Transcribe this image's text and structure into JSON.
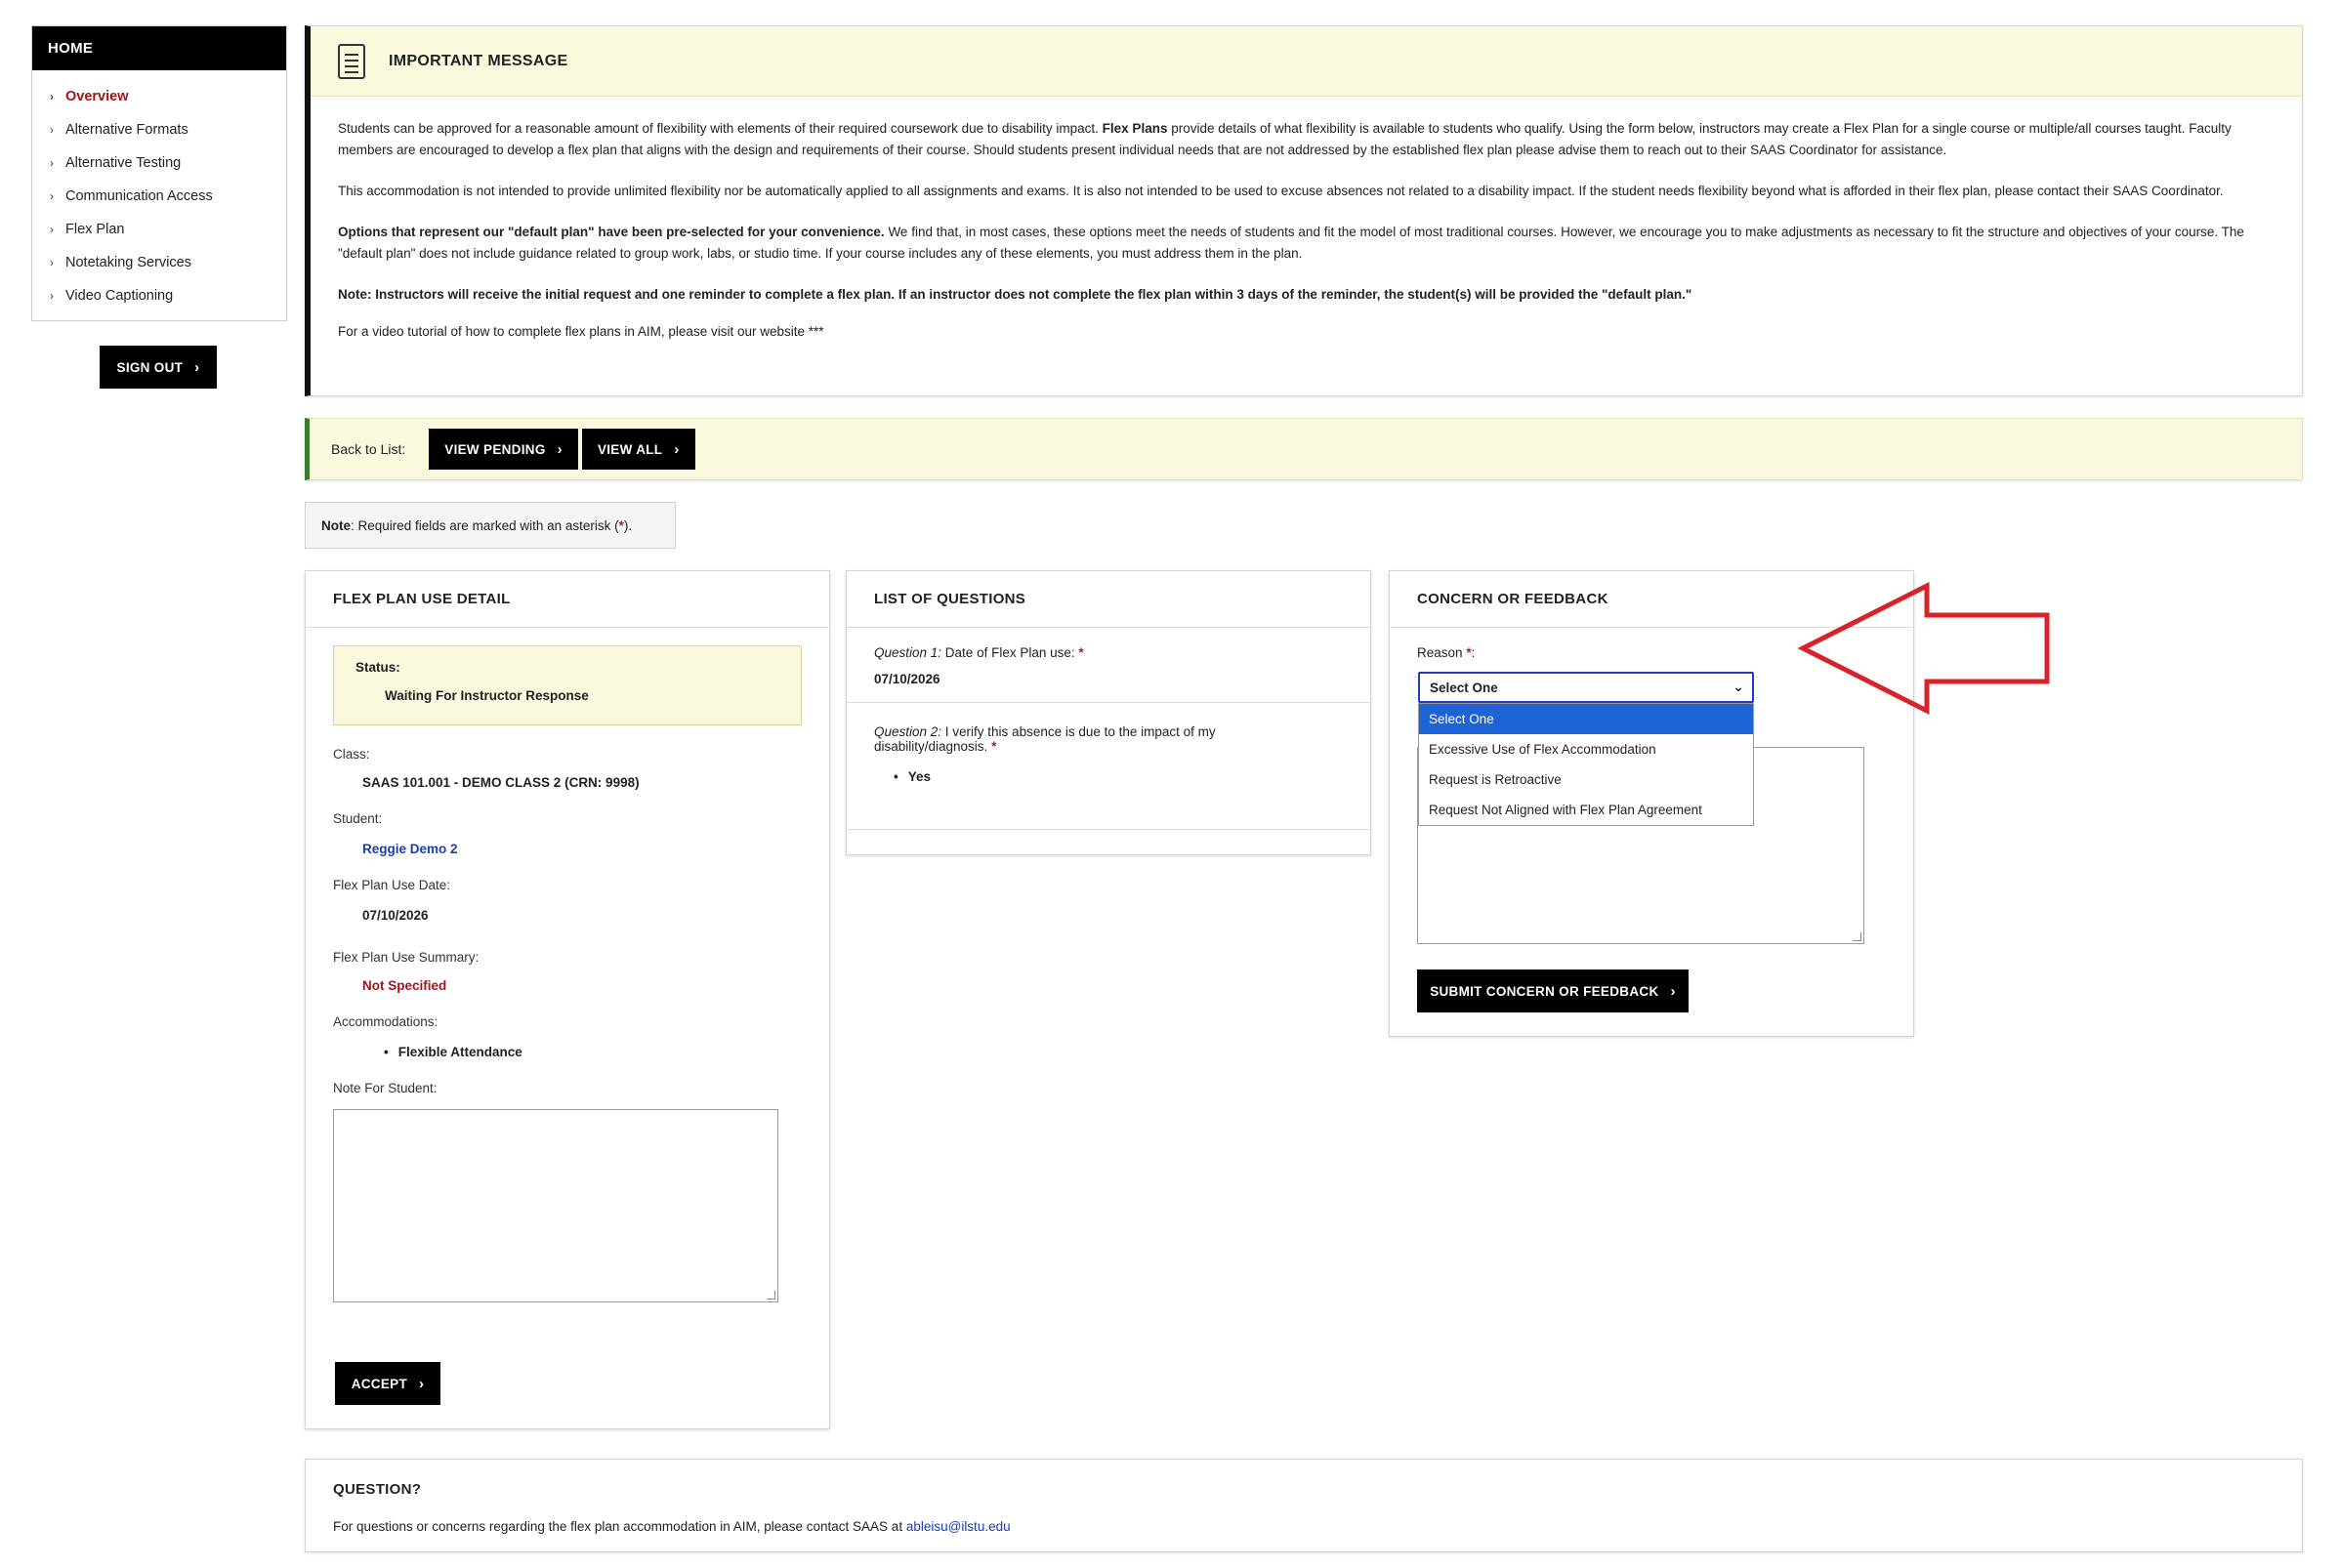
{
  "sidebar": {
    "heading": "HOME",
    "items": [
      {
        "label": "Overview"
      },
      {
        "label": "Alternative Formats"
      },
      {
        "label": "Alternative Testing"
      },
      {
        "label": "Communication Access"
      },
      {
        "label": "Flex Plan"
      },
      {
        "label": "Notetaking Services"
      },
      {
        "label": "Video Captioning"
      }
    ],
    "sign_out_label": "SIGN OUT"
  },
  "message": {
    "title": "IMPORTANT MESSAGE",
    "p1_a": "Students can be approved for a reasonable amount of flexibility with elements of their required coursework due to disability impact. ",
    "p1_bold": "Flex Plans",
    "p1_b": " provide details of what flexibility is available to students who qualify. Using the form below, instructors may create a Flex Plan for a single course or multiple/all courses taught. Faculty members are encouraged to develop a flex plan that aligns with the design and requirements of their course. Should students present individual needs that are not addressed by the established flex plan please advise them to reach out to their SAAS Coordinator for assistance.",
    "p2": "This accommodation is not intended to provide unlimited flexibility nor be automatically applied to all assignments and exams. It is also not intended to be used to excuse absences not related to a disability impact. If the student needs flexibility beyond what is afforded in their flex plan, please contact their SAAS Coordinator.",
    "p3_bold": "Options that represent our \"default plan\" have been pre-selected for your convenience.",
    "p3_rest": " We find that, in most cases, these options meet the needs of students and fit the model of most traditional courses. However, we encourage you to make adjustments as necessary to fit the structure and objectives of your course. The \"default plan\" does not include guidance related to group work, labs, or studio time. If your course includes any of these elements, you must address them in the plan.",
    "p4": "Note: Instructors will receive the initial request and one reminder to complete a flex plan. If an instructor does not complete the flex plan within 3 days of the reminder, the student(s) will be provided the \"default plan.\"",
    "p5": "For a video tutorial of how to complete flex plans in AIM, please visit our website ***"
  },
  "backbar": {
    "label": "Back to List:",
    "view_pending": "VIEW PENDING",
    "view_all": "VIEW ALL"
  },
  "note": {
    "bold": "Note",
    "text_a": ": Required fields are marked with an asterisk (",
    "asterisk": "*",
    "text_b": ")."
  },
  "detail": {
    "title": "FLEX PLAN USE DETAIL",
    "status_label": "Status:",
    "status_value": "Waiting For Instructor Response",
    "class_label": "Class:",
    "class_value": "SAAS 101.001 - DEMO CLASS 2 (CRN: 9998)",
    "student_label": "Student:",
    "student_value": "Reggie Demo 2",
    "date_label": "Flex Plan Use Date:",
    "date_value": "07/10/2026",
    "summary_label": "Flex Plan Use Summary:",
    "summary_value": "Not Specified",
    "accom_label": "Accommodations:",
    "accom_items": [
      "Flexible Attendance"
    ],
    "note_label": "Note For Student:",
    "accept_label": "ACCEPT"
  },
  "questions": {
    "title": "LIST OF QUESTIONS",
    "q1_prefix": "Question 1:",
    "q1_text": " Date of Flex Plan use:",
    "q1_answer": "07/10/2026",
    "q2_prefix": "Question 2:",
    "q2_text_line1": " I verify this absence is due to the impact of my",
    "q2_text_line2": "disability/diagnosis.",
    "q2_answer": "Yes",
    "asterisk": "*"
  },
  "concern": {
    "title": "CONCERN OR FEEDBACK",
    "reason_label": "Reason",
    "asterisk": "*",
    "colon": ":",
    "selected": "Select One",
    "options": [
      "Select One",
      "Excessive Use of Flex Accommodation",
      "Request is Retroactive",
      "Request Not Aligned with Flex Plan Agreement"
    ],
    "submit_label": "SUBMIT CONCERN OR FEEDBACK"
  },
  "question_section": {
    "title": "QUESTION?",
    "text": "For questions or concerns regarding the flex plan accommodation in AIM, please contact SAAS at ",
    "email": "ableisu@ilstu.edu"
  },
  "colors": {
    "accent_red": "#a3141a",
    "link_blue": "#1a3bb3",
    "highlight_yellow": "#fbf9dd",
    "annotation_arrow": "#d9232a"
  },
  "icons": [
    "chevron-right-icon",
    "document-icon",
    "chevron-down-icon",
    "annotation-arrow-icon"
  ]
}
